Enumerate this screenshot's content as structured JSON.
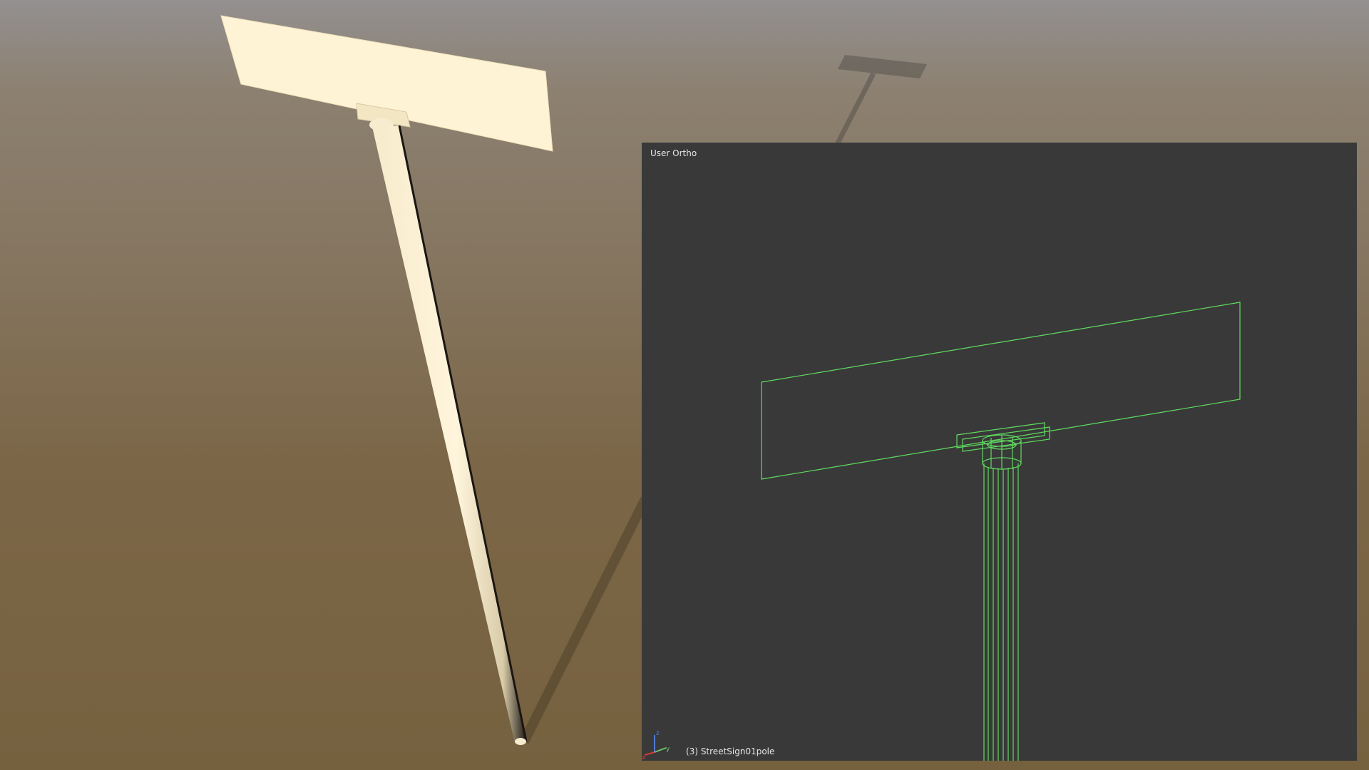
{
  "viewport": {
    "view_label": "User Ortho",
    "object_label": "(3) StreetSign01pole"
  },
  "axis_gizmo": {
    "x_label": "x",
    "y_label": "y",
    "z_label": "z",
    "x_color": "#d63a3a",
    "y_color": "#6cc46c",
    "z_color": "#4f7ad6"
  },
  "colors": {
    "sign_cream": "#fff3d6",
    "pole_shadow": "#1a1612",
    "wireframe": "#5fdc5f",
    "viewport_bg": "#393939",
    "viewport_text": "#e6e6e6"
  },
  "icons": {
    "axis_gizmo": "axis-gizmo-icon"
  }
}
